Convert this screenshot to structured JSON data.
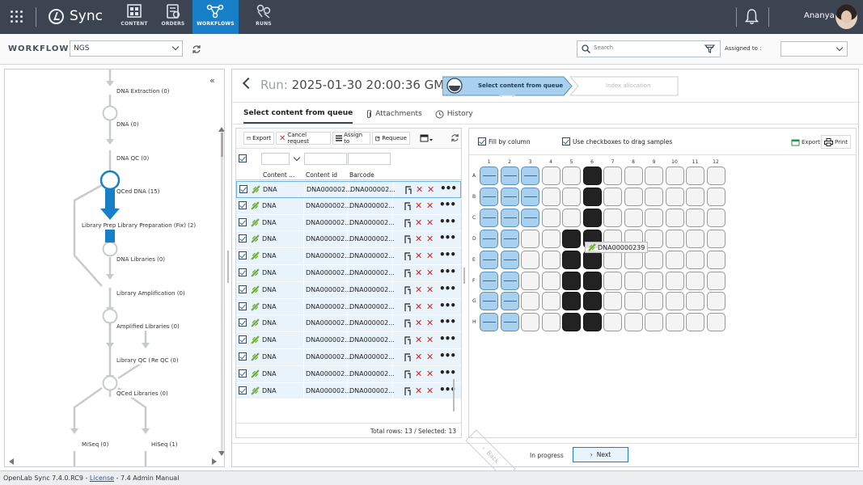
{
  "app": {
    "name": "Sync",
    "user": "Ananya"
  },
  "nav": [
    {
      "label": "CONTENT"
    },
    {
      "label": "ORDERS"
    },
    {
      "label": "WORKFLOWS",
      "active": true
    },
    {
      "label": "RUNS"
    }
  ],
  "workflows": {
    "label": "WORKFLOWS",
    "selected": "NGS"
  },
  "search": {
    "placeholder": "Search"
  },
  "assigned": {
    "label": "Assigned to :",
    "value": ""
  },
  "flow": {
    "nodes": [
      {
        "label": "DNA Extraction (0)"
      },
      {
        "label": "DNA (0)"
      },
      {
        "label": "DNA QC (0)"
      },
      {
        "label": "QCed DNA (15)"
      },
      {
        "label": "Library Prep Library Preparation (Fix) (2)"
      },
      {
        "label": "DNA Libraries (0)"
      },
      {
        "label": "Library Amplification (0)"
      },
      {
        "label": "Amplified Libraries (0)"
      },
      {
        "label": "Library QC (0)"
      },
      {
        "label": "Re QC (0)"
      },
      {
        "label": "QCed Libraries (0)"
      },
      {
        "label": "MiSeq (0)"
      },
      {
        "label": "HiSeq (1)"
      }
    ]
  },
  "run": {
    "label": "Run:",
    "timestamp": "2025-01-30 20:00:36 GMT",
    "steps": [
      {
        "label": "Select content from queue",
        "active": true
      },
      {
        "label": "Index allocation",
        "active": false
      }
    ]
  },
  "tabs": [
    {
      "label": "Select content from queue",
      "active": true
    },
    {
      "label": "Attachments"
    },
    {
      "label": "History"
    }
  ],
  "queue": {
    "toolbar": {
      "export": "Export",
      "cancel": "Cancel request",
      "assign": "Assign to",
      "requeue": "Requeue"
    },
    "columns": [
      "Content ...",
      "Content id",
      "Barcode"
    ],
    "rows": [
      {
        "type": "DNA",
        "id": "DNA000002...",
        "barcode": "DNA000002..."
      },
      {
        "type": "DNA",
        "id": "DNA000002...",
        "barcode": "DNA000002..."
      },
      {
        "type": "DNA",
        "id": "DNA000002...",
        "barcode": "DNA000002..."
      },
      {
        "type": "DNA",
        "id": "DNA000002...",
        "barcode": "DNA000002..."
      },
      {
        "type": "DNA",
        "id": "DNA000002...",
        "barcode": "DNA000002..."
      },
      {
        "type": "DNA",
        "id": "DNA000002...",
        "barcode": "DNA000002..."
      },
      {
        "type": "DNA",
        "id": "DNA000002...",
        "barcode": "DNA000002..."
      },
      {
        "type": "DNA",
        "id": "DNA000002...",
        "barcode": "DNA000002..."
      },
      {
        "type": "DNA",
        "id": "DNA000002...",
        "barcode": "DNA000002..."
      },
      {
        "type": "DNA",
        "id": "DNA000002...",
        "barcode": "DNA000002..."
      },
      {
        "type": "DNA",
        "id": "DNA000002...",
        "barcode": "DNA000002..."
      },
      {
        "type": "DNA",
        "id": "DNA000002...",
        "barcode": "DNA000002..."
      },
      {
        "type": "DNA",
        "id": "DNA000002...",
        "barcode": "DNA000002..."
      }
    ],
    "footer": "Total rows: 13 / Selected: 13"
  },
  "plate": {
    "fill_by_column": "Fill by column",
    "use_checkboxes": "Use checkboxes to drag samples",
    "export": "Export",
    "print": "Print",
    "columns": [
      "1",
      "2",
      "3",
      "4",
      "5",
      "6",
      "7",
      "8",
      "9",
      "10",
      "11",
      "12"
    ],
    "rows": [
      "A",
      "B",
      "C",
      "D",
      "E",
      "F",
      "G",
      "H"
    ],
    "drag_label": "DNA00000239"
  },
  "bottom": {
    "back": "Back",
    "status": "In progress",
    "next": "Next"
  },
  "footer": {
    "product": "OpenLab Sync 7.4.0.RC9 -",
    "license": "License",
    "manual": "- 7.4 Admin Manual"
  }
}
